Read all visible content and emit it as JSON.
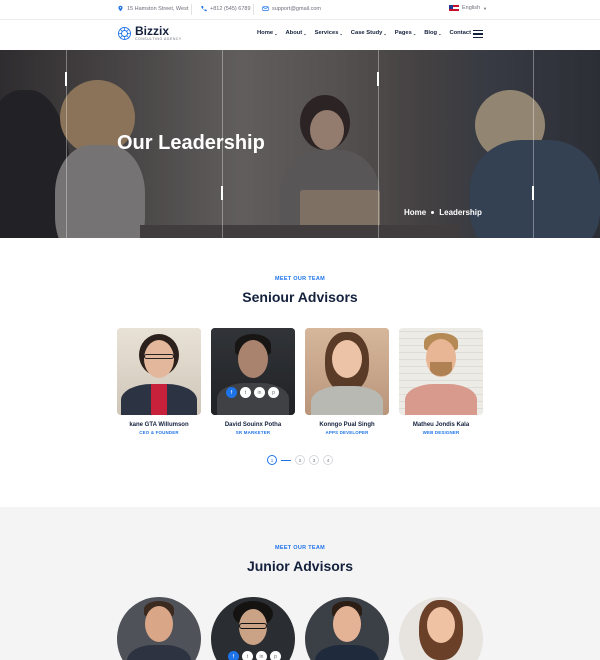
{
  "topbar": {
    "address": "15 Hamston Street, West",
    "phone": "+812 (545) 6789",
    "email": "support@gmail.com",
    "language": "English"
  },
  "header": {
    "logo_name": "Bizzix",
    "logo_sub": "CONSULTING AGENCY",
    "nav": [
      {
        "label": "Home",
        "dropdown": true
      },
      {
        "label": "About",
        "dropdown": true
      },
      {
        "label": "Services",
        "dropdown": true
      },
      {
        "label": "Case Study",
        "dropdown": true
      },
      {
        "label": "Pages",
        "dropdown": true
      },
      {
        "label": "Blog",
        "dropdown": true
      },
      {
        "label": "Contact",
        "dropdown": false
      }
    ]
  },
  "hero": {
    "title": "Our Leadership",
    "breadcrumb_home": "Home",
    "breadcrumb_current": "Leadership"
  },
  "senior": {
    "label": "MEET OUR TEAM",
    "title": "Seniour Advisors",
    "members": [
      {
        "name": "kane GTA Willumson",
        "role": "CEO & FOUNDER"
      },
      {
        "name": "David Souinx Potha",
        "role": "SR MARKETER"
      },
      {
        "name": "Konngo Pual Singh",
        "role": "APPS DEVELOPER"
      },
      {
        "name": "Matheu Jondis Kala",
        "role": "WEB DESIGNER"
      }
    ],
    "socials": [
      "f",
      "t",
      "in",
      "p"
    ],
    "pages": [
      "1",
      "2",
      "3",
      "4"
    ],
    "active_page": "1"
  },
  "junior": {
    "label": "MEET OUR TEAM",
    "title": "Junior Advisors"
  },
  "colors": {
    "accent": "#1e73e8",
    "heading": "#14213d",
    "junior_bg": "#f4f4f4"
  }
}
